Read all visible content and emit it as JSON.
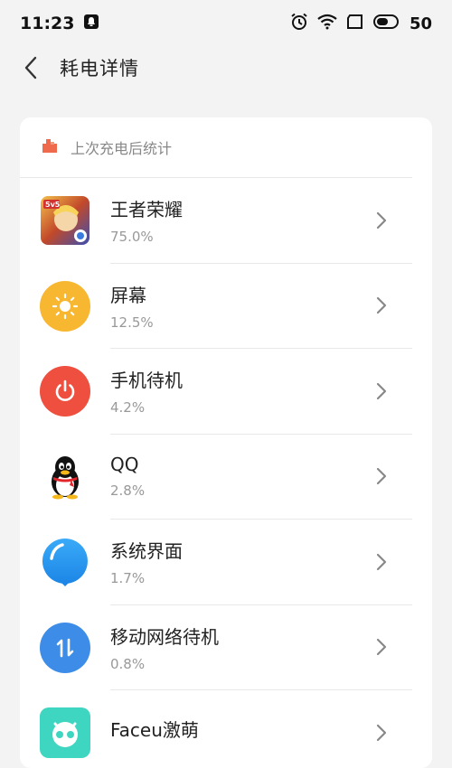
{
  "status_bar": {
    "time": "11:23",
    "battery": "50"
  },
  "header": {
    "title": "耗电详情"
  },
  "section": {
    "title": "上次充电后统计"
  },
  "items": [
    {
      "name": "王者荣耀",
      "percent": "75.0%",
      "icon": "honor-of-kings-icon"
    },
    {
      "name": "屏幕",
      "percent": "12.5%",
      "icon": "brightness-icon"
    },
    {
      "name": "手机待机",
      "percent": "4.2%",
      "icon": "power-icon"
    },
    {
      "name": "QQ",
      "percent": "2.8%",
      "icon": "qq-penguin-icon"
    },
    {
      "name": "系统界面",
      "percent": "1.7%",
      "icon": "system-ui-icon"
    },
    {
      "name": "移动网络待机",
      "percent": "0.8%",
      "icon": "mobile-data-icon"
    },
    {
      "name": "Faceu激萌",
      "percent": "",
      "icon": "faceu-icon"
    }
  ],
  "colors": {
    "brightness": "#f7b731",
    "power": "#ef4f3f",
    "system_ui": "#2e9bf0",
    "mobile_data": "#3d8de8",
    "faceu": "#3ed6c0",
    "section_icon": "#ef6a4c"
  }
}
